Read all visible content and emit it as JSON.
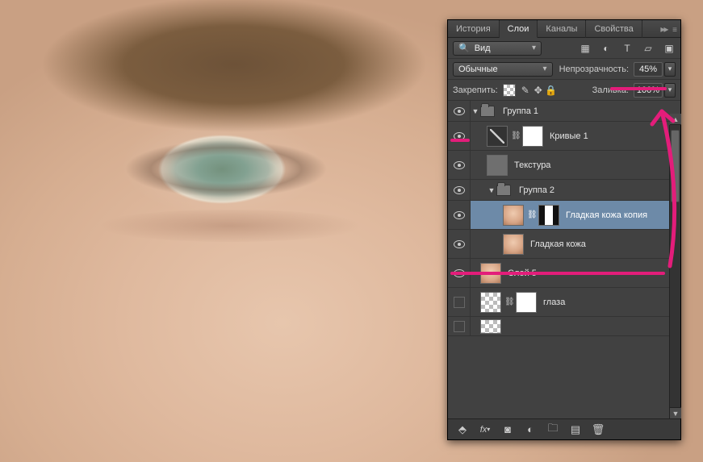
{
  "tabs": {
    "history": "История",
    "layers": "Слои",
    "channels": "Каналы",
    "properties": "Свойства"
  },
  "search": {
    "label": "Вид"
  },
  "blend": {
    "mode": "Обычные",
    "opacity_label": "Непрозрачность:",
    "opacity_value": "45%"
  },
  "lock": {
    "label": "Закрепить:",
    "fill_label": "Заливка:",
    "fill_value": "100%"
  },
  "layers": {
    "group1": "Группа 1",
    "curves1": "Кривые 1",
    "texture": "Текстура",
    "group2": "Группа 2",
    "smooth_copy": "Гладкая кожа копия",
    "smooth": "Гладкая кожа",
    "layer5": "Слой 5",
    "eyes": "глаза"
  },
  "bottom": {
    "fx": "fx"
  }
}
